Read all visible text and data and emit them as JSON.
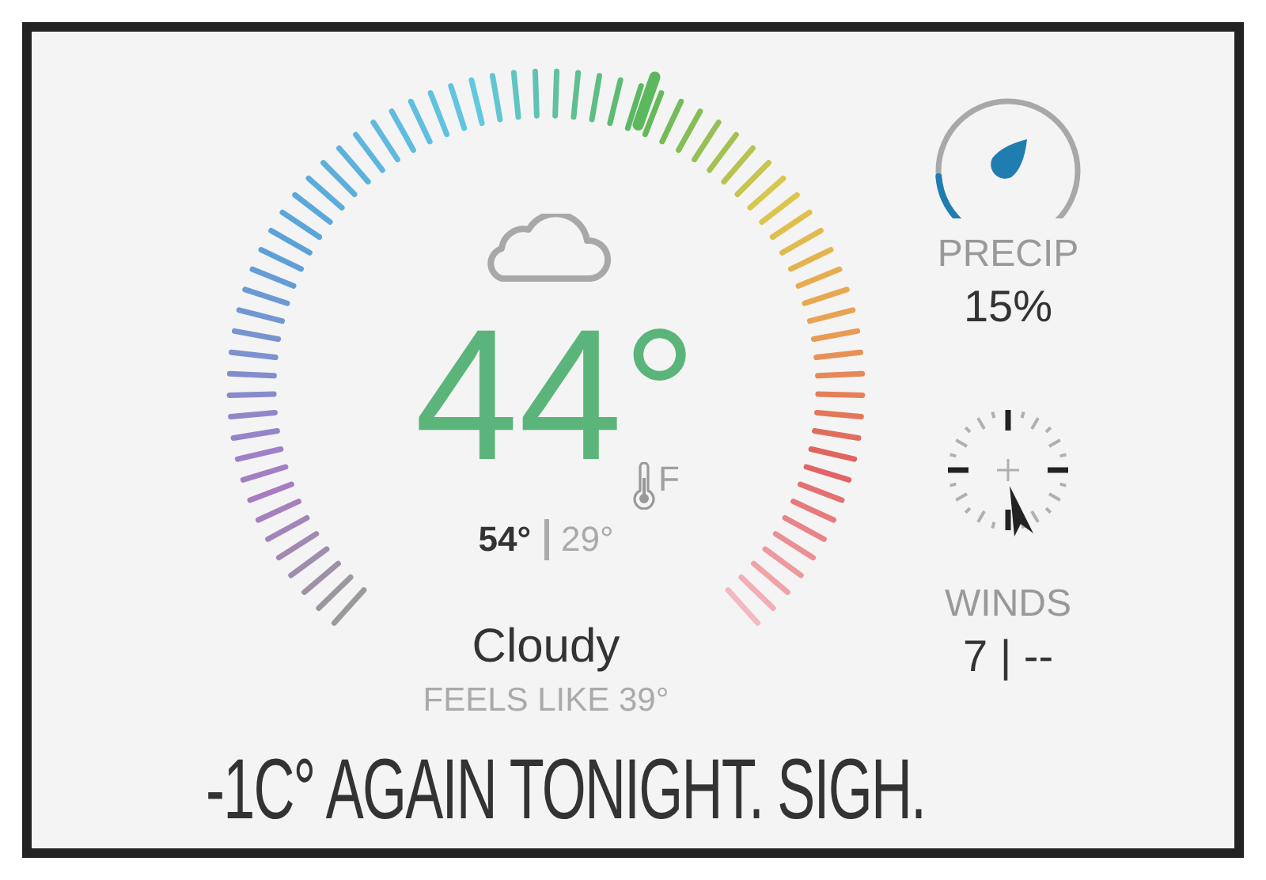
{
  "temperature": {
    "value": "44°",
    "unit": "F",
    "high": "54°",
    "low": "29°",
    "condition": "Cloudy",
    "feels_like": "FEELS LIKE 39°"
  },
  "precip": {
    "label": "PRECIP",
    "value": "15%"
  },
  "winds": {
    "label": "WINDS",
    "value": "7 | --"
  },
  "caption": "-1C° AGAIN TONIGHT. SIGH."
}
